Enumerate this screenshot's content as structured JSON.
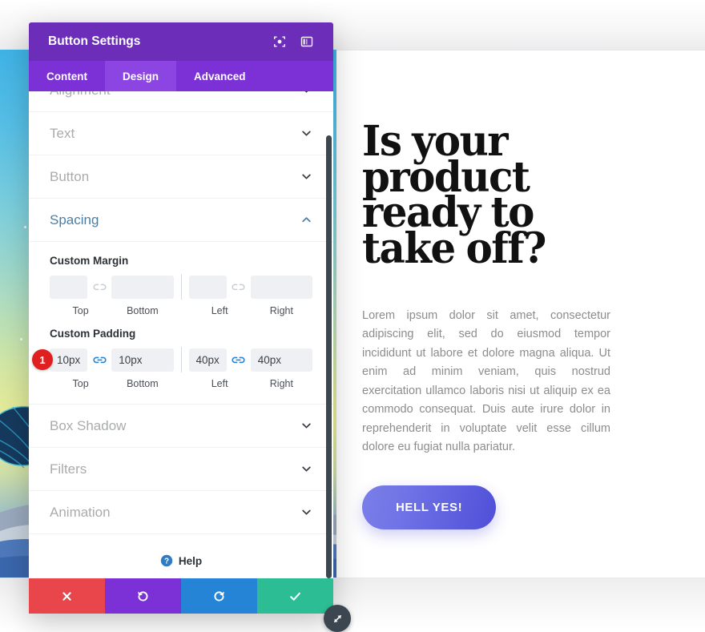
{
  "modal": {
    "title": "Button Settings",
    "header_icons": [
      {
        "name": "focus-icon"
      },
      {
        "name": "layout-columns-icon"
      }
    ],
    "tabs": [
      {
        "label": "Content",
        "active": false
      },
      {
        "label": "Design",
        "active": true
      },
      {
        "label": "Advanced",
        "active": false
      }
    ],
    "accordions_top": [
      {
        "label": "Alignment",
        "state": "collapsed"
      },
      {
        "label": "Text",
        "state": "collapsed"
      },
      {
        "label": "Button",
        "state": "collapsed"
      }
    ],
    "spacing": {
      "label": "Spacing",
      "state": "expanded",
      "custom_margin": {
        "title": "Custom Margin",
        "link_state": "unlinked",
        "fields": [
          {
            "label": "Top",
            "value": ""
          },
          {
            "label": "Bottom",
            "value": ""
          },
          {
            "label": "Left",
            "value": ""
          },
          {
            "label": "Right",
            "value": ""
          }
        ]
      },
      "custom_padding": {
        "title": "Custom Padding",
        "link_state": "linked",
        "badge": "1",
        "fields": [
          {
            "label": "Top",
            "value": "10px"
          },
          {
            "label": "Bottom",
            "value": "10px"
          },
          {
            "label": "Left",
            "value": "40px"
          },
          {
            "label": "Right",
            "value": "40px"
          }
        ]
      }
    },
    "accordions_bottom": [
      {
        "label": "Box Shadow",
        "state": "collapsed"
      },
      {
        "label": "Filters",
        "state": "collapsed"
      },
      {
        "label": "Animation",
        "state": "collapsed"
      }
    ],
    "help": {
      "label": "Help",
      "icon": "help-circle-icon"
    },
    "footer_buttons": [
      {
        "name": "cancel-button",
        "icon": "close-icon",
        "color": "#e8464a"
      },
      {
        "name": "undo-button",
        "icon": "undo-icon",
        "color": "#7b31d6"
      },
      {
        "name": "redo-button",
        "icon": "redo-icon",
        "color": "#2584d6"
      },
      {
        "name": "save-button",
        "icon": "check-icon",
        "color": "#2cbd94"
      }
    ],
    "resize_handle": {
      "icon": "resize-diagonal-icon"
    },
    "colors": {
      "header": "#6c2eb9",
      "tabbar": "#7b31d6",
      "tab_active": "#8c45e2",
      "active_section": "#4a7fa5",
      "badge": "#e02020",
      "link_active": "#2584d6",
      "link_inactive": "#c9ced4"
    }
  },
  "page": {
    "headline": "Is your product ready to take off?",
    "body": "Lorem ipsum dolor sit amet, consectetur adipiscing elit, sed do eiusmod tempor incididunt ut labore et dolore magna aliqua. Ut enim ad minim veniam, quis nostrud exercitation ullamco laboris nisi ut aliquip ex ea commodo consequat. Duis aute irure dolor in reprehenderit in voluptate velit esse cillum dolore eu fugiat nulla pariatur.",
    "cta_label": "HELL YES!",
    "cta_gradient_from": "#7b7fe8",
    "cta_gradient_to": "#4f4fd8",
    "hero_art": {
      "name": "whale-sky-illustration"
    }
  }
}
